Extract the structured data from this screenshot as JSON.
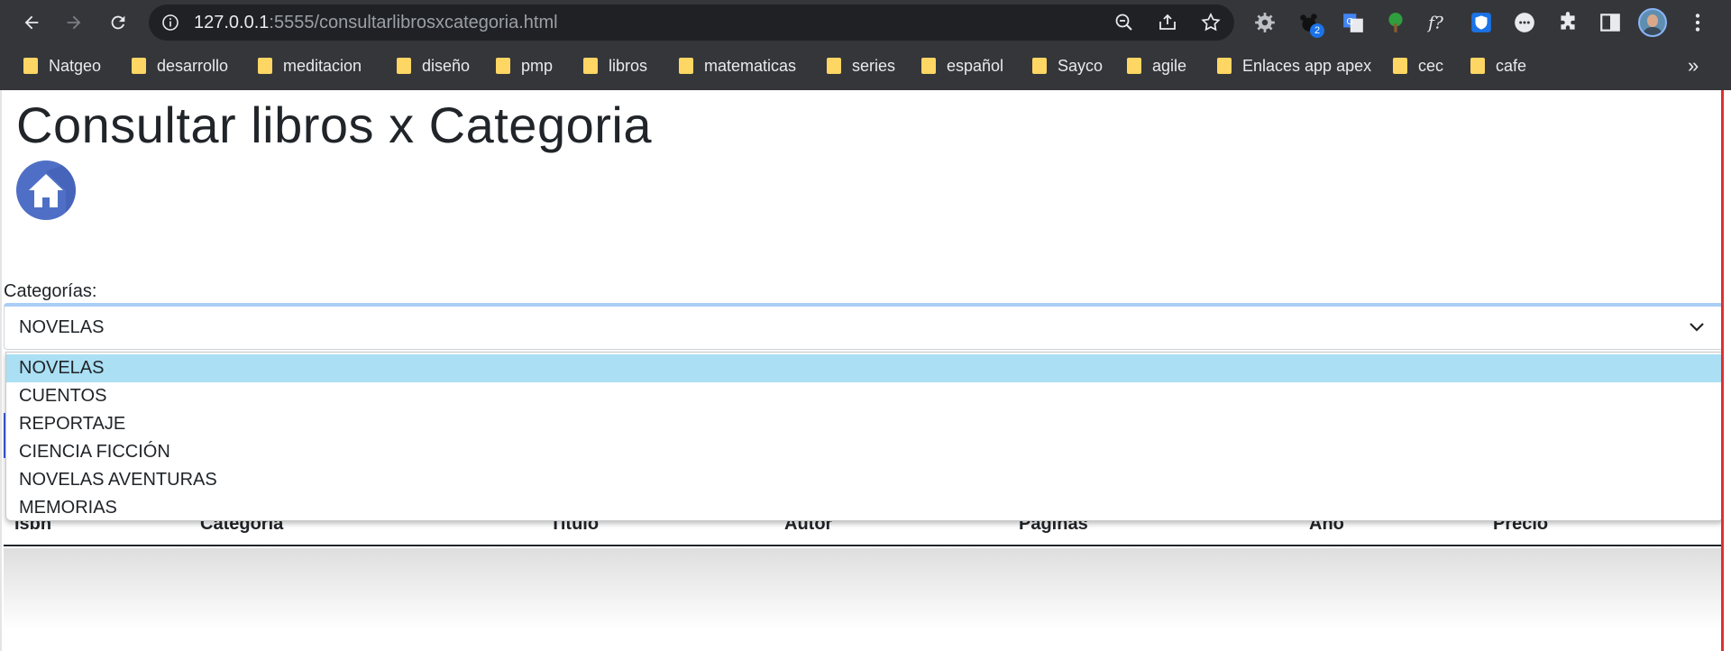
{
  "browser": {
    "url_host": "127.0.0.1",
    "url_path": ":5555/consultarlibrosxcategoria.html",
    "extension_badge": "2",
    "bookmarks": [
      "Natgeo",
      "desarrollo",
      "meditacion",
      "diseño",
      "pmp",
      "libros",
      "matematicas",
      "series",
      "español",
      "Sayco",
      "agile",
      "Enlaces app apex",
      "cec",
      "cafe"
    ],
    "more_bookmarks": "»"
  },
  "page": {
    "title": "Consultar libros x Categoria",
    "category_label": "Categorías:",
    "selected_category": "NOVELAS",
    "options": [
      "NOVELAS",
      "CUENTOS",
      "REPORTAJE",
      "CIENCIA FICCIÓN",
      "NOVELAS AVENTURAS",
      "MEMORIAS"
    ],
    "table_headers": [
      "Isbn",
      "Categoria",
      "Titulo",
      "Autor",
      "Paginas",
      "Año",
      "Precio"
    ]
  },
  "colors": {
    "chrome_bg": "#35363a",
    "omnibox_bg": "#202124",
    "selected_option": "#aadff4",
    "home_button": "#4f6fc7"
  }
}
